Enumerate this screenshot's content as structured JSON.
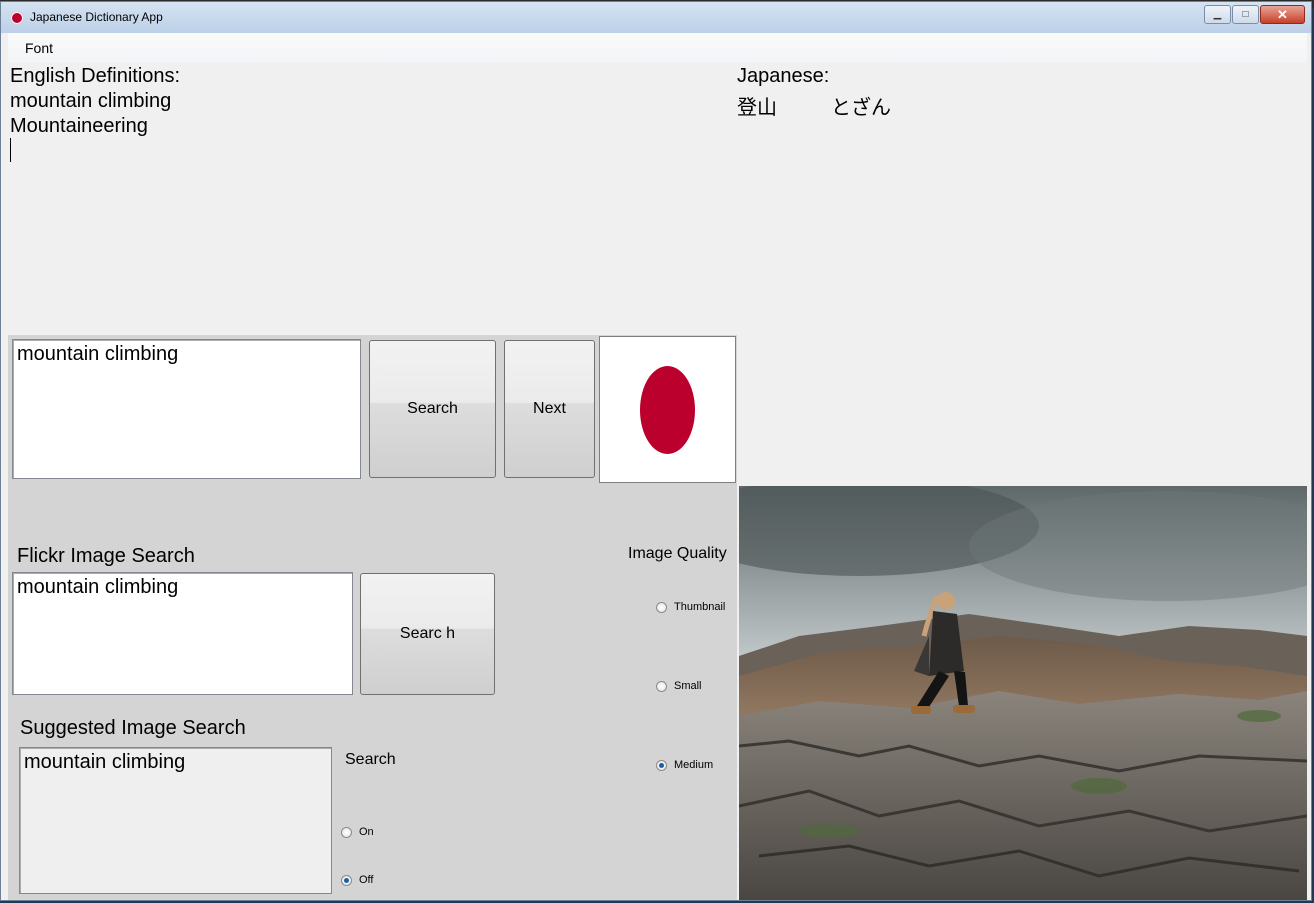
{
  "window": {
    "title": "Japanese Dictionary App"
  },
  "menu": {
    "font": "Font"
  },
  "definitions": {
    "header": "English Definitions:",
    "lines": [
      "mountain climbing",
      "Mountaineering"
    ]
  },
  "japanese": {
    "header": "Japanese:",
    "kanji": "登山",
    "kana": "とざん"
  },
  "search": {
    "input_value": "mountain climbing",
    "search_label": "Search",
    "next_label": "Next"
  },
  "flickr": {
    "header": "Flickr Image Search",
    "input_value": "mountain climbing",
    "search_label": "Searc h"
  },
  "image_quality": {
    "header": "Image Quality",
    "options": [
      "Thumbnail",
      "Small",
      "Medium"
    ],
    "selected": "Medium"
  },
  "suggested": {
    "header": "Suggested Image Search",
    "input_value": "mountain climbing",
    "search_label": "Search",
    "options": [
      "On",
      "Off"
    ],
    "selected": "Off"
  },
  "colors": {
    "flag_red": "#bc002d",
    "accent_blue": "#1c5fa8"
  }
}
